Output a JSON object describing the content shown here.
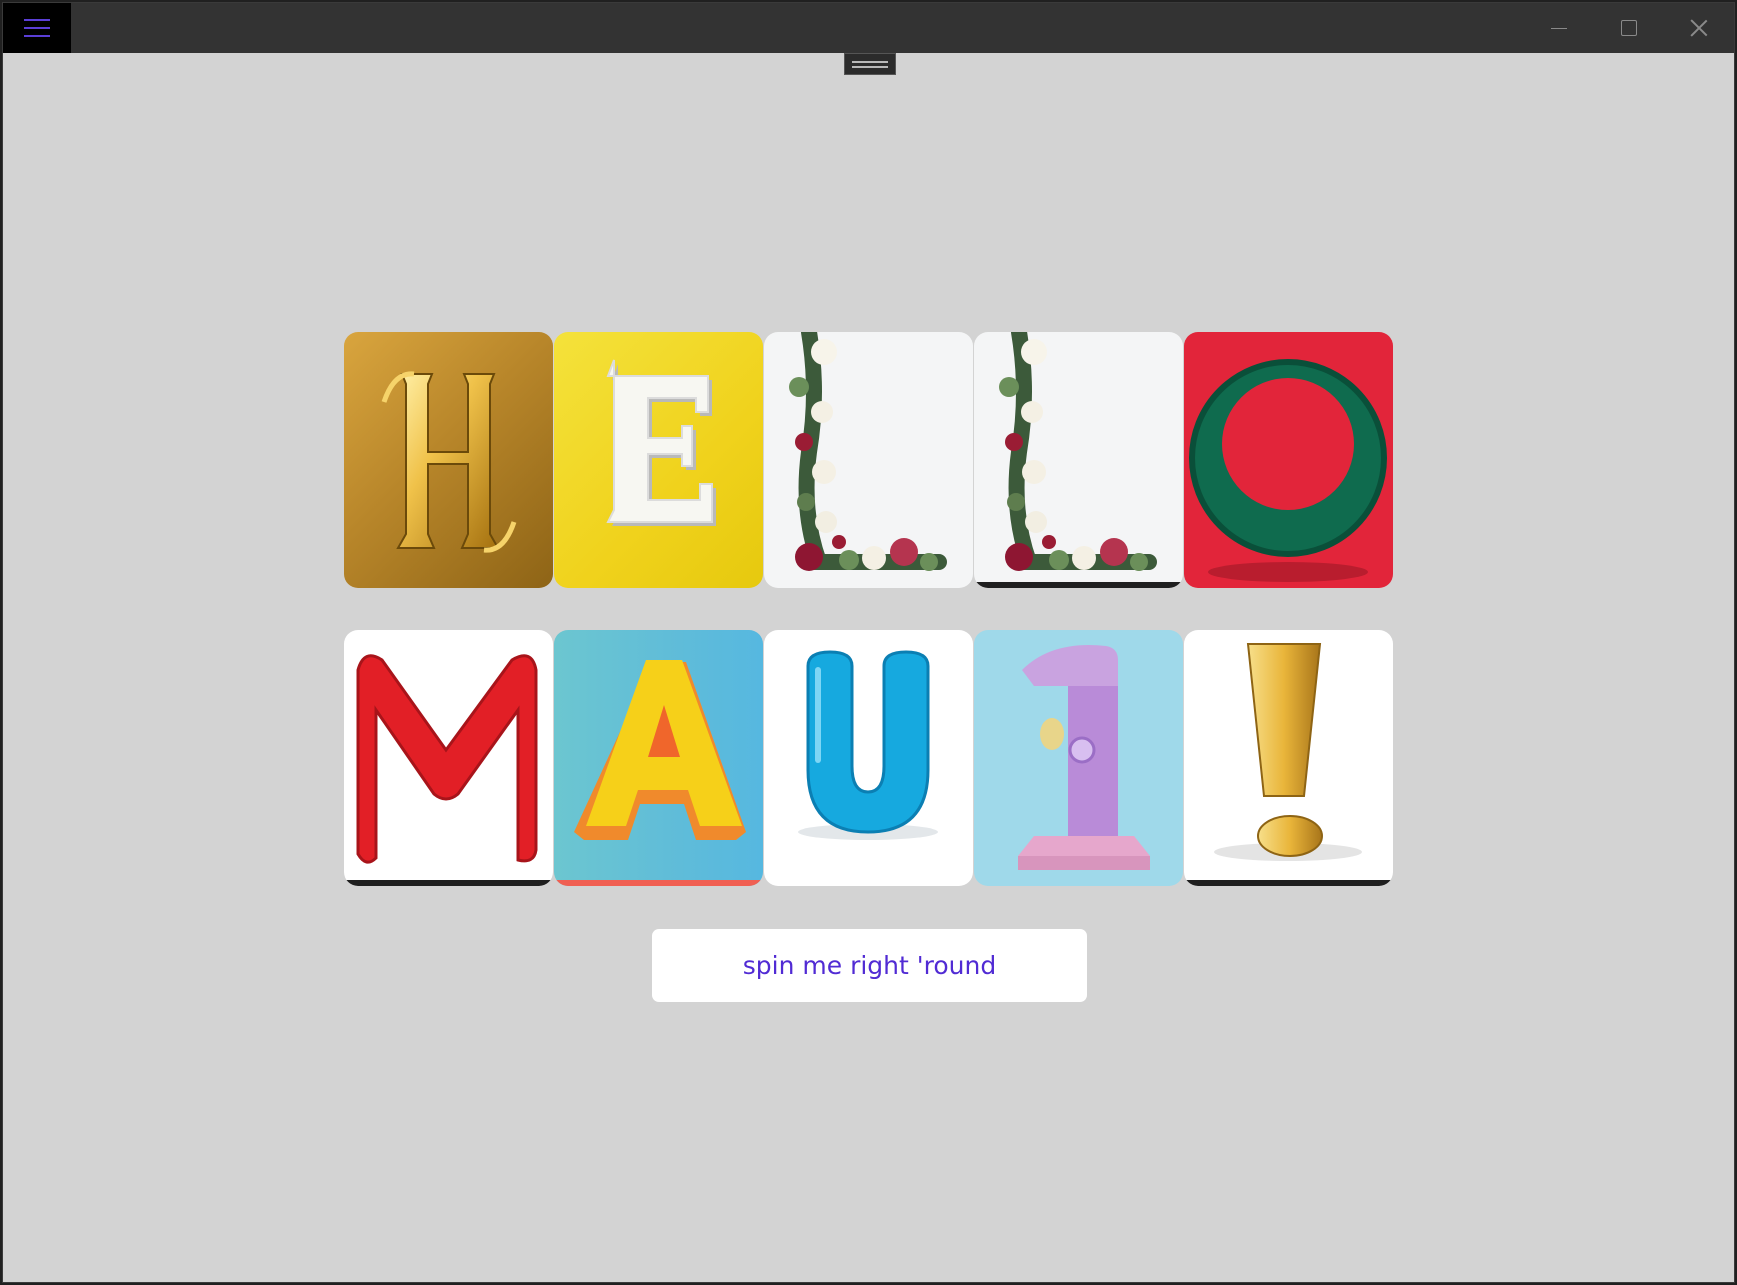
{
  "titlebar": {
    "menu_icon": "hamburger-menu-icon",
    "controls": [
      "minimize-icon",
      "maximize-icon",
      "close-icon"
    ]
  },
  "tiles": {
    "row1": [
      {
        "letter": "H",
        "icon": "golden-h-letter-image"
      },
      {
        "letter": "E",
        "icon": "white-e-letter-image"
      },
      {
        "letter": "L",
        "icon": "floral-l-letter-image"
      },
      {
        "letter": "L",
        "icon": "floral-l-letter-image"
      },
      {
        "letter": "O",
        "icon": "green-ring-o-image"
      }
    ],
    "row2": [
      {
        "letter": "M",
        "icon": "red-clay-m-letter-image"
      },
      {
        "letter": "A",
        "icon": "yellow-a-letter-image"
      },
      {
        "letter": "U",
        "icon": "blue-balloon-u-letter-image"
      },
      {
        "letter": "1",
        "icon": "lavender-number-one-image"
      },
      {
        "letter": "!",
        "icon": "gold-exclamation-image"
      }
    ]
  },
  "button": {
    "label": "spin me right 'round"
  },
  "colors": {
    "accent": "#512bd4",
    "background": "#d3d3d3",
    "titlebar": "#333333"
  }
}
